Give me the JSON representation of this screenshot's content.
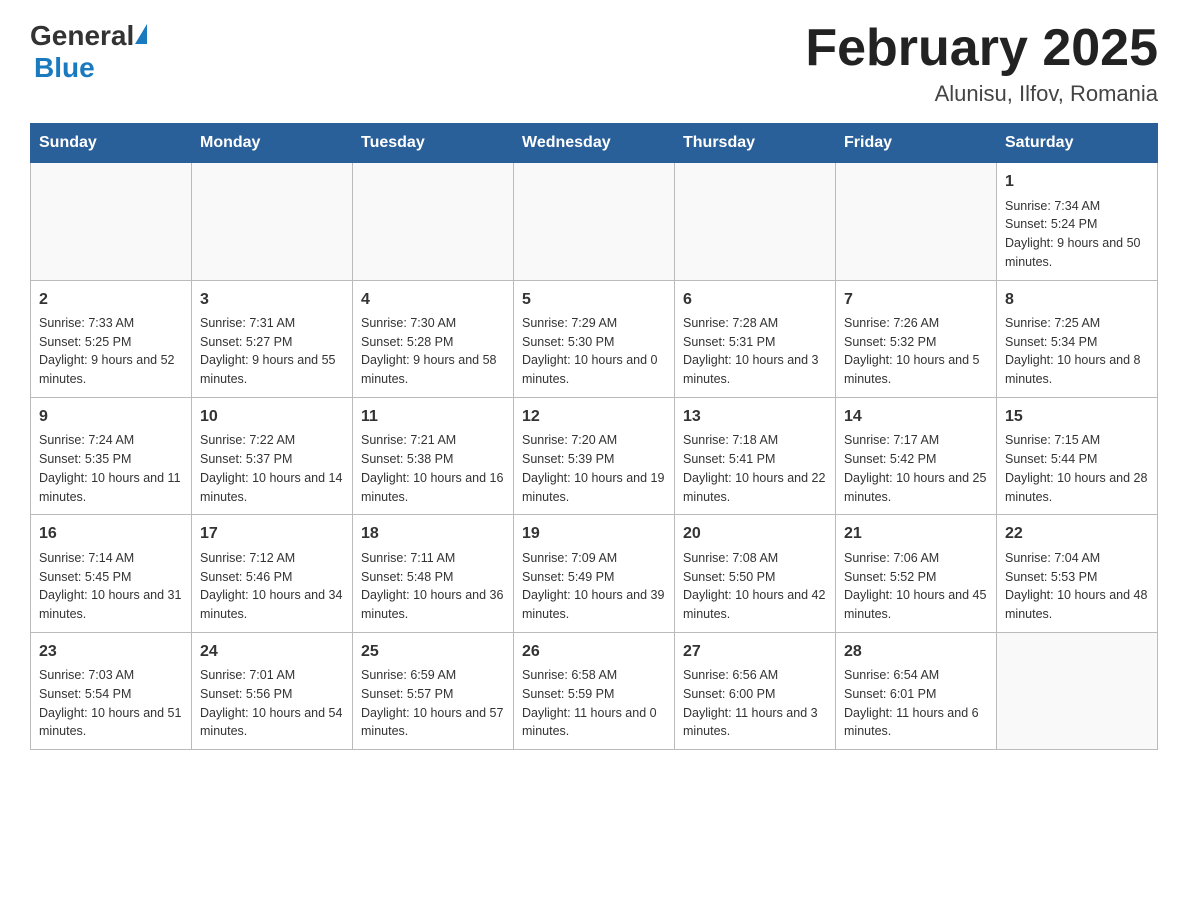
{
  "header": {
    "logo_general": "General",
    "logo_blue": "Blue",
    "month_title": "February 2025",
    "location": "Alunisu, Ilfov, Romania"
  },
  "days_of_week": [
    "Sunday",
    "Monday",
    "Tuesday",
    "Wednesday",
    "Thursday",
    "Friday",
    "Saturday"
  ],
  "weeks": [
    [
      {
        "day": "",
        "info": ""
      },
      {
        "day": "",
        "info": ""
      },
      {
        "day": "",
        "info": ""
      },
      {
        "day": "",
        "info": ""
      },
      {
        "day": "",
        "info": ""
      },
      {
        "day": "",
        "info": ""
      },
      {
        "day": "1",
        "info": "Sunrise: 7:34 AM\nSunset: 5:24 PM\nDaylight: 9 hours and 50 minutes."
      }
    ],
    [
      {
        "day": "2",
        "info": "Sunrise: 7:33 AM\nSunset: 5:25 PM\nDaylight: 9 hours and 52 minutes."
      },
      {
        "day": "3",
        "info": "Sunrise: 7:31 AM\nSunset: 5:27 PM\nDaylight: 9 hours and 55 minutes."
      },
      {
        "day": "4",
        "info": "Sunrise: 7:30 AM\nSunset: 5:28 PM\nDaylight: 9 hours and 58 minutes."
      },
      {
        "day": "5",
        "info": "Sunrise: 7:29 AM\nSunset: 5:30 PM\nDaylight: 10 hours and 0 minutes."
      },
      {
        "day": "6",
        "info": "Sunrise: 7:28 AM\nSunset: 5:31 PM\nDaylight: 10 hours and 3 minutes."
      },
      {
        "day": "7",
        "info": "Sunrise: 7:26 AM\nSunset: 5:32 PM\nDaylight: 10 hours and 5 minutes."
      },
      {
        "day": "8",
        "info": "Sunrise: 7:25 AM\nSunset: 5:34 PM\nDaylight: 10 hours and 8 minutes."
      }
    ],
    [
      {
        "day": "9",
        "info": "Sunrise: 7:24 AM\nSunset: 5:35 PM\nDaylight: 10 hours and 11 minutes."
      },
      {
        "day": "10",
        "info": "Sunrise: 7:22 AM\nSunset: 5:37 PM\nDaylight: 10 hours and 14 minutes."
      },
      {
        "day": "11",
        "info": "Sunrise: 7:21 AM\nSunset: 5:38 PM\nDaylight: 10 hours and 16 minutes."
      },
      {
        "day": "12",
        "info": "Sunrise: 7:20 AM\nSunset: 5:39 PM\nDaylight: 10 hours and 19 minutes."
      },
      {
        "day": "13",
        "info": "Sunrise: 7:18 AM\nSunset: 5:41 PM\nDaylight: 10 hours and 22 minutes."
      },
      {
        "day": "14",
        "info": "Sunrise: 7:17 AM\nSunset: 5:42 PM\nDaylight: 10 hours and 25 minutes."
      },
      {
        "day": "15",
        "info": "Sunrise: 7:15 AM\nSunset: 5:44 PM\nDaylight: 10 hours and 28 minutes."
      }
    ],
    [
      {
        "day": "16",
        "info": "Sunrise: 7:14 AM\nSunset: 5:45 PM\nDaylight: 10 hours and 31 minutes."
      },
      {
        "day": "17",
        "info": "Sunrise: 7:12 AM\nSunset: 5:46 PM\nDaylight: 10 hours and 34 minutes."
      },
      {
        "day": "18",
        "info": "Sunrise: 7:11 AM\nSunset: 5:48 PM\nDaylight: 10 hours and 36 minutes."
      },
      {
        "day": "19",
        "info": "Sunrise: 7:09 AM\nSunset: 5:49 PM\nDaylight: 10 hours and 39 minutes."
      },
      {
        "day": "20",
        "info": "Sunrise: 7:08 AM\nSunset: 5:50 PM\nDaylight: 10 hours and 42 minutes."
      },
      {
        "day": "21",
        "info": "Sunrise: 7:06 AM\nSunset: 5:52 PM\nDaylight: 10 hours and 45 minutes."
      },
      {
        "day": "22",
        "info": "Sunrise: 7:04 AM\nSunset: 5:53 PM\nDaylight: 10 hours and 48 minutes."
      }
    ],
    [
      {
        "day": "23",
        "info": "Sunrise: 7:03 AM\nSunset: 5:54 PM\nDaylight: 10 hours and 51 minutes."
      },
      {
        "day": "24",
        "info": "Sunrise: 7:01 AM\nSunset: 5:56 PM\nDaylight: 10 hours and 54 minutes."
      },
      {
        "day": "25",
        "info": "Sunrise: 6:59 AM\nSunset: 5:57 PM\nDaylight: 10 hours and 57 minutes."
      },
      {
        "day": "26",
        "info": "Sunrise: 6:58 AM\nSunset: 5:59 PM\nDaylight: 11 hours and 0 minutes."
      },
      {
        "day": "27",
        "info": "Sunrise: 6:56 AM\nSunset: 6:00 PM\nDaylight: 11 hours and 3 minutes."
      },
      {
        "day": "28",
        "info": "Sunrise: 6:54 AM\nSunset: 6:01 PM\nDaylight: 11 hours and 6 minutes."
      },
      {
        "day": "",
        "info": ""
      }
    ]
  ]
}
